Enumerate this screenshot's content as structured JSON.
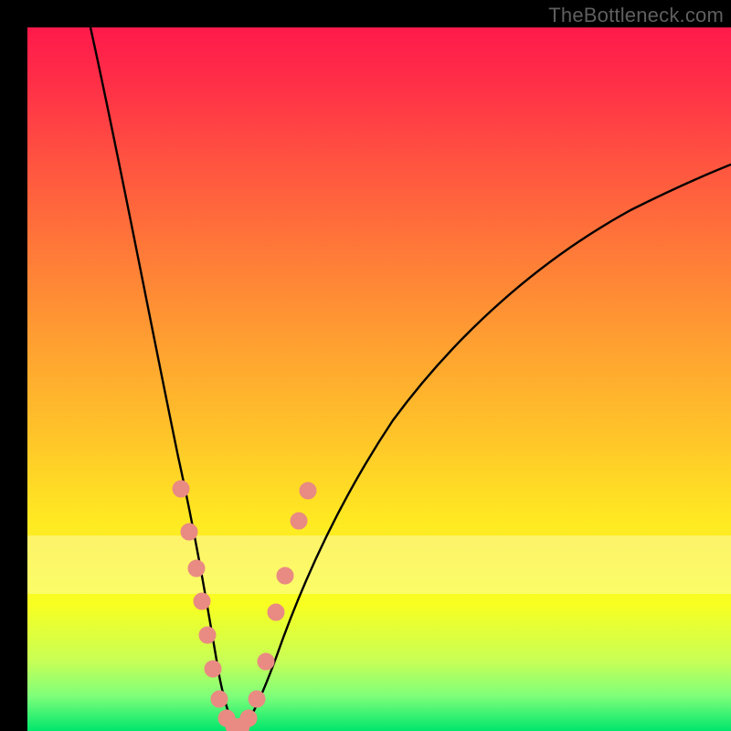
{
  "watermark": "TheBottleneck.com",
  "chart_data": {
    "type": "line",
    "title": "",
    "xlabel": "",
    "ylabel": "",
    "xlim": [
      0,
      100
    ],
    "ylim": [
      0,
      100
    ],
    "series": [
      {
        "name": "left-branch",
        "x": [
          9,
          12,
          15,
          18,
          20,
          22,
          23,
          24,
          25,
          25.5,
          26,
          27,
          28,
          29
        ],
        "y": [
          100,
          86,
          72,
          58,
          47,
          37,
          31,
          24,
          17,
          12,
          8,
          4,
          1,
          0
        ]
      },
      {
        "name": "right-branch",
        "x": [
          29,
          30,
          31,
          32,
          34,
          36,
          40,
          46,
          54,
          64,
          76,
          90,
          100
        ],
        "y": [
          0,
          1,
          3,
          7,
          14,
          22,
          34,
          47,
          58,
          67,
          74,
          80,
          84
        ]
      }
    ],
    "markers": {
      "name": "highlight-dots",
      "color": "#e98b82",
      "points": [
        {
          "x": 21.5,
          "y": 34
        },
        {
          "x": 22.8,
          "y": 28
        },
        {
          "x": 23.7,
          "y": 23
        },
        {
          "x": 24.5,
          "y": 18
        },
        {
          "x": 25.3,
          "y": 13
        },
        {
          "x": 26.0,
          "y": 8
        },
        {
          "x": 27.0,
          "y": 4
        },
        {
          "x": 28.0,
          "y": 1.5
        },
        {
          "x": 29.0,
          "y": 0.5
        },
        {
          "x": 30.0,
          "y": 0.5
        },
        {
          "x": 31.0,
          "y": 1.5
        },
        {
          "x": 32.0,
          "y": 4
        },
        {
          "x": 33.3,
          "y": 10
        },
        {
          "x": 34.8,
          "y": 17
        },
        {
          "x": 36.0,
          "y": 22
        },
        {
          "x": 38.0,
          "y": 30
        },
        {
          "x": 39.3,
          "y": 34
        }
      ]
    },
    "bands": [
      {
        "name": "pale-band",
        "y0": 20,
        "y1": 28
      }
    ]
  }
}
